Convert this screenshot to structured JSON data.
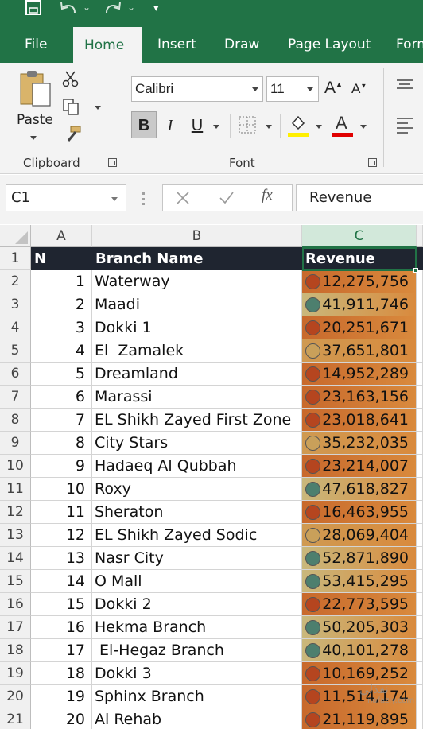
{
  "colors": {
    "accent": "#217346",
    "header_fill": "#1f2530",
    "high": "#4d7f6e",
    "mid": "#c9a05a",
    "low": "#b5451f"
  },
  "quick_access": {
    "save_icon": "save-icon",
    "undo_icon": "undo-icon",
    "redo_icon": "redo-icon",
    "customize_icon": "customize-qat-icon"
  },
  "tabs": [
    "File",
    "Home",
    "Insert",
    "Draw",
    "Page Layout",
    "Form"
  ],
  "ribbon": {
    "clipboard": {
      "label": "Clipboard",
      "paste_label": "Paste"
    },
    "font": {
      "label": "Font",
      "font_name": "Calibri",
      "font_size": "11",
      "bold": "B",
      "italic": "I",
      "underline": "U"
    }
  },
  "formula_bar": {
    "name_box": "C1",
    "fx": "fx",
    "value": "Revenue"
  },
  "sheet": {
    "columns": [
      "A",
      "B",
      "C"
    ],
    "header": {
      "n": "N",
      "branch": "Branch Name",
      "revenue": "Revenue"
    },
    "rows": [
      {
        "row": "1"
      },
      {
        "row": "2",
        "n": "1",
        "branch": "Waterway",
        "revenue": "12,275,756",
        "icon": "low"
      },
      {
        "row": "3",
        "n": "2",
        "branch": "Maadi",
        "revenue": "41,911,746",
        "icon": "high"
      },
      {
        "row": "4",
        "n": "3",
        "branch": "Dokki 1",
        "revenue": "20,251,671",
        "icon": "low"
      },
      {
        "row": "5",
        "n": "4",
        "branch": "El  Zamalek",
        "revenue": "37,651,801",
        "icon": "mid"
      },
      {
        "row": "6",
        "n": "5",
        "branch": "Dreamland",
        "revenue": "14,952,289",
        "icon": "low"
      },
      {
        "row": "7",
        "n": "6",
        "branch": "Marassi",
        "revenue": "23,163,156",
        "icon": "low"
      },
      {
        "row": "8",
        "n": "7",
        "branch": "EL Shikh Zayed First Zone",
        "revenue": "23,018,641",
        "icon": "low"
      },
      {
        "row": "9",
        "n": "8",
        "branch": "City Stars",
        "revenue": "35,232,035",
        "icon": "mid"
      },
      {
        "row": "10",
        "n": "9",
        "branch": "Hadaeq Al Qubbah",
        "revenue": "23,214,007",
        "icon": "low"
      },
      {
        "row": "11",
        "n": "10",
        "branch": "Roxy",
        "revenue": "47,618,827",
        "icon": "high"
      },
      {
        "row": "12",
        "n": "11",
        "branch": "Sheraton",
        "revenue": "16,463,955",
        "icon": "low"
      },
      {
        "row": "13",
        "n": "12",
        "branch": "EL Shikh Zayed Sodic",
        "revenue": "28,069,404",
        "icon": "mid"
      },
      {
        "row": "14",
        "n": "13",
        "branch": "Nasr City",
        "revenue": "52,871,890",
        "icon": "high"
      },
      {
        "row": "15",
        "n": "14",
        "branch": "O Mall",
        "revenue": "53,415,295",
        "icon": "high"
      },
      {
        "row": "16",
        "n": "15",
        "branch": "Dokki 2",
        "revenue": "22,773,595",
        "icon": "low"
      },
      {
        "row": "17",
        "n": "16",
        "branch": "Hekma Branch",
        "revenue": "50,205,303",
        "icon": "high"
      },
      {
        "row": "18",
        "n": "17",
        "branch": " El-Hegaz Branch",
        "revenue": "40,101,278",
        "icon": "high"
      },
      {
        "row": "19",
        "n": "18",
        "branch": "Dokki 3",
        "revenue": "10,169,252",
        "icon": "low"
      },
      {
        "row": "20",
        "n": "19",
        "branch": "Sphinx Branch",
        "revenue": "11,514,174",
        "icon": "low"
      },
      {
        "row": "21",
        "n": "20",
        "branch": "Al Rehab",
        "revenue": "21,119,895",
        "icon": "low"
      }
    ]
  },
  "watermark": {
    "arabic": "نفذلي",
    "latin": "nafazly.com"
  }
}
